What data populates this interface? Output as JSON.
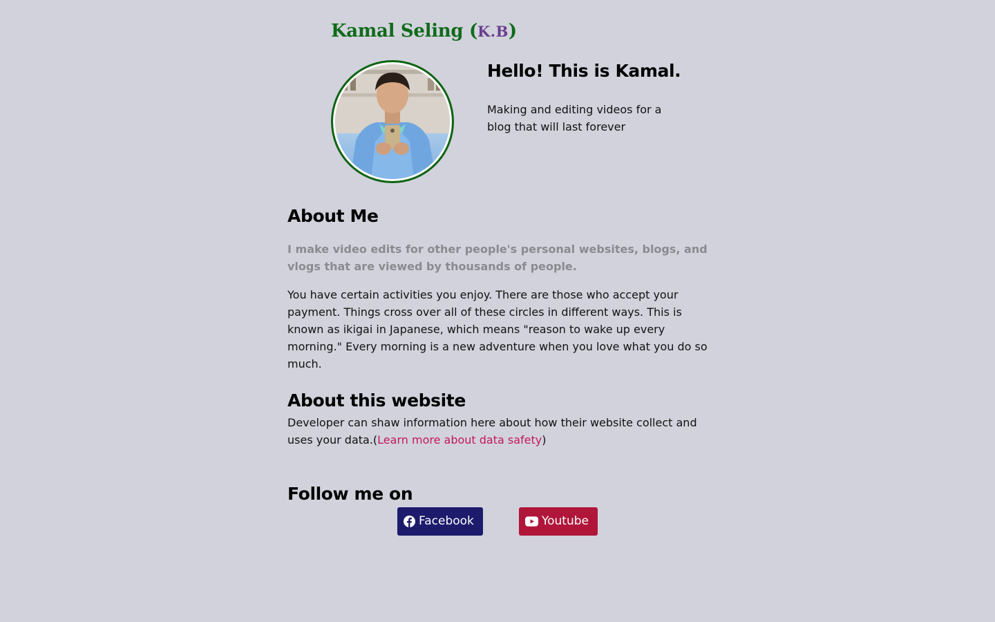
{
  "header": {
    "site_name": "Kamal Seling (",
    "initials": "K.B",
    "close_paren": ")"
  },
  "avatar": {
    "alt": "Kamal profile photo"
  },
  "hero": {
    "heading": "Hello! This is Kamal.",
    "text": "Making and editing videos for a blog that will last forever"
  },
  "about": {
    "heading": "About Me",
    "lead": "I make video edits for other people's personal websites, blogs, and vlogs that are viewed by thousands of people.",
    "body": "You have certain activities you enjoy. There are those who accept your payment. Things cross over all of these circles in different ways. This is known as ikigai in Japanese, which means \"reason to wake up every morning.\" Every morning is a new adventure when you love what you do so much."
  },
  "about_website": {
    "heading": "About this website",
    "text_before": "Developer can shaw information here about how their website collect and uses your data.(",
    "link_text": "Learn more about data safety",
    "text_after": ")"
  },
  "follow": {
    "heading": "Follow me on",
    "facebook_label": "Facebook",
    "youtube_label": "Youtube",
    "facebook_icon": "facebook-icon",
    "youtube_icon": "youtube-icon"
  },
  "colors": {
    "background": "#d2d2dc",
    "title_green": "#0f6b1a",
    "initials_purple": "#6a3f8e",
    "link_pink": "#c2185b",
    "facebook_navy": "#1d1b6b",
    "youtube_red": "#b0163a"
  }
}
